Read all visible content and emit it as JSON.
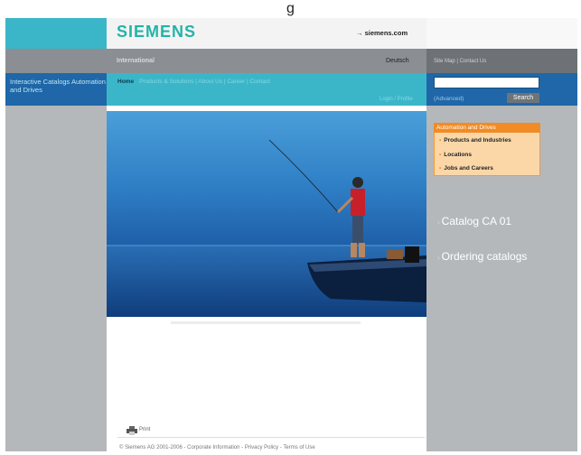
{
  "caption": "g",
  "left": {
    "title": "Interactive Catalogs Automation and Drives"
  },
  "header": {
    "logo": "SIEMENS",
    "siemens_link": "→ siemens.com",
    "international": "International",
    "language": "Deutsch",
    "sitemap": "Site Map | Contact Us"
  },
  "nav": {
    "home": "Home",
    "items": "Products & Solutions | About Us | Career | Contact",
    "login": "Login / Profile"
  },
  "search": {
    "value": "",
    "advanced": "(Advanced)",
    "button": "Search"
  },
  "orange_box": {
    "title": "Automation and Drives",
    "items": [
      "Products and Industries",
      "Locations",
      "Jobs and Careers"
    ]
  },
  "links": {
    "catalog": "Catalog CA 01",
    "ordering": "Ordering catalogs"
  },
  "print": {
    "label": "Print"
  },
  "footer": "© Siemens AG 2001-2006 - Corporate Information - Privacy Policy - Terms of Use",
  "colors": {
    "teal": "#3bb6c9",
    "blue": "#1f67a8",
    "gray": "#b5b8bb",
    "orange": "#f18b25",
    "logo": "#23b4a7"
  }
}
